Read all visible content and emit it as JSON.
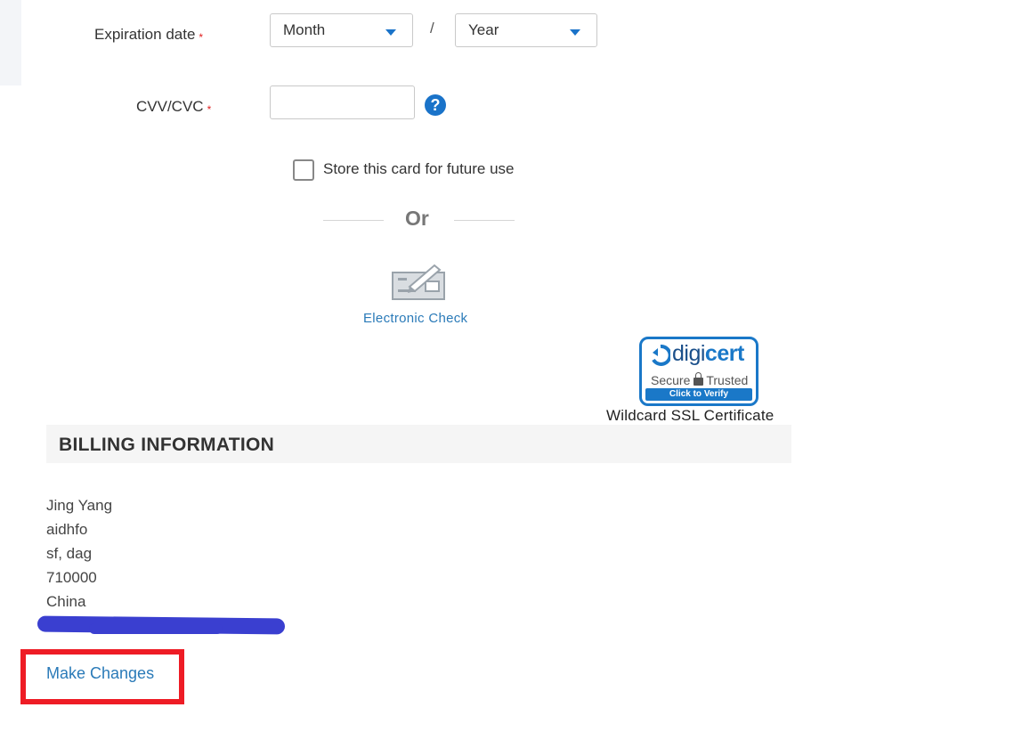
{
  "payment_form": {
    "expiration": {
      "label": "Expiration date",
      "required_marker": "*",
      "month_value": "Month",
      "separator": "/",
      "year_value": "Year"
    },
    "cvv": {
      "label": "CVV/CVC",
      "required_marker": "*",
      "value": "",
      "help_glyph": "?"
    },
    "store_card": {
      "label": "Store this card for future use",
      "checked": false
    },
    "divider_text": "Or",
    "electronic_check": {
      "label": "Electronic Check",
      "icon": "check-payment-icon"
    },
    "ssl_badge": {
      "brand_prefix": "digi",
      "brand_suffix": "cert",
      "secure_text": "Secure",
      "trusted_text": "Trusted",
      "verify_text": "Click to Verify",
      "caption": "Wildcard SSL Certificate"
    }
  },
  "billing": {
    "title": "BILLING INFORMATION",
    "address_lines": [
      "Jing Yang",
      "aidhfo",
      "sf, dag",
      "710000",
      "China"
    ],
    "make_changes_label": "Make Changes"
  },
  "colors": {
    "accent": "#1a73c9",
    "link": "#2a7ab8",
    "required": "#e02020",
    "highlight": "#ee1c25",
    "redaction": "#3a3fd0"
  }
}
